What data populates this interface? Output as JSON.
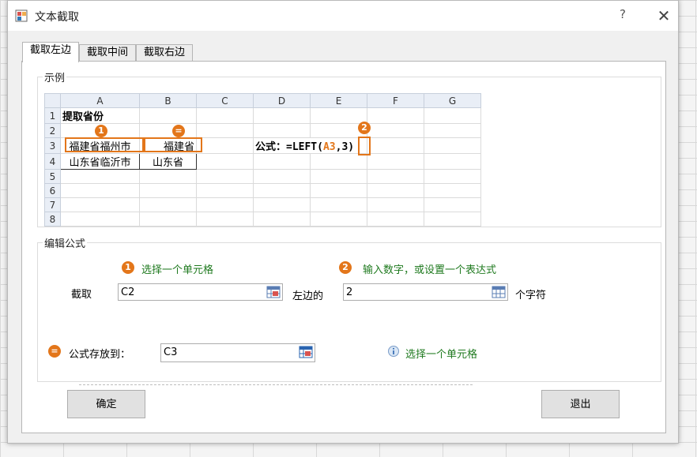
{
  "window": {
    "title": "文本截取",
    "help_label": "?",
    "close_label": "✕"
  },
  "tabs": [
    {
      "label": "截取左边"
    },
    {
      "label": "截取中间"
    },
    {
      "label": "截取右边"
    }
  ],
  "example": {
    "group_title": "示例",
    "columns": [
      "A",
      "B",
      "C",
      "D",
      "E",
      "F",
      "G"
    ],
    "rows": [
      "1",
      "2",
      "3",
      "4",
      "5",
      "6",
      "7",
      "8"
    ],
    "a1": "提取省份",
    "a3": "福建省福州市",
    "b3": "福建省",
    "a4": "山东省临沂市",
    "b4": "山东省",
    "formula_prefix": "公式：=LEFT(",
    "formula_ref": "A3",
    "formula_sep": ",",
    "formula_num": "3",
    "formula_suffix": ")",
    "badge1": "1",
    "badge_eq": "=",
    "badge2": "2"
  },
  "edit": {
    "group_title": "编辑公式",
    "hint1_badge": "1",
    "hint1": "选择一个单元格",
    "hint2_badge": "2",
    "hint2": "输入数字，或设置一个表达式",
    "extract_label": "截取",
    "cell_value": "C2",
    "left_label": "左边的",
    "count_value": "2",
    "chars_label": "个字符",
    "store_badge": "=",
    "store_label": "公式存放到：",
    "store_value": "C3",
    "info_hint": "选择一个单元格"
  },
  "buttons": {
    "ok": "确定",
    "exit": "退出"
  },
  "colors": {
    "accent": "#e3761a",
    "hint_green": "#1f7a1f"
  }
}
